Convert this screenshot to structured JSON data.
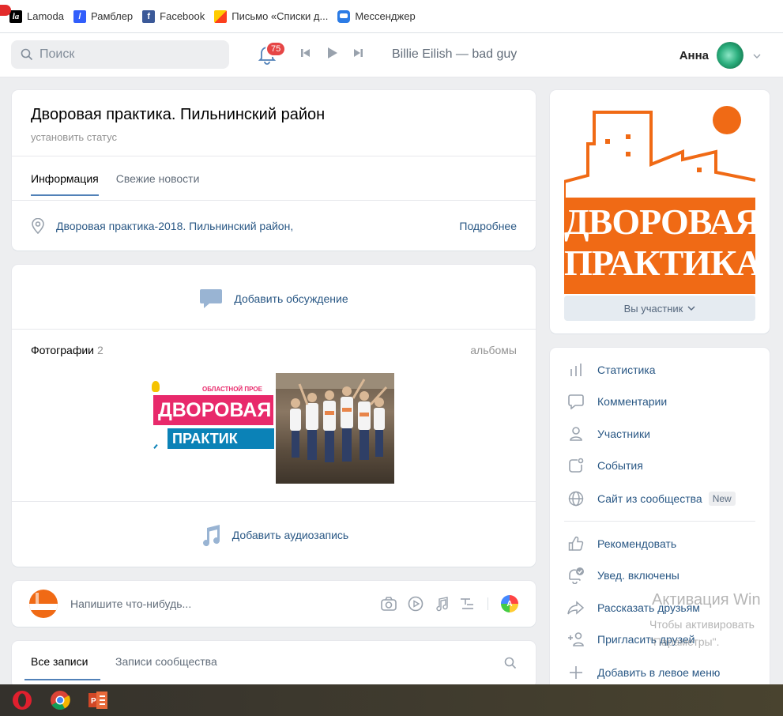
{
  "bookmarks": [
    {
      "label": "Lamoda",
      "icon": "lamoda-icon",
      "color": "#000000",
      "glyph": "la"
    },
    {
      "label": "Рамблер",
      "icon": "rambler-icon",
      "color": "#315efb",
      "glyph": "/"
    },
    {
      "label": "Facebook",
      "icon": "facebook-icon",
      "color": "#3b5998",
      "glyph": "f"
    },
    {
      "label": "Письмо «Списки д...",
      "icon": "mail-icon",
      "color": "#fc3f1d",
      "glyph": "✉"
    },
    {
      "label": "Мессенджер",
      "icon": "messenger-icon",
      "color": "#2b7be5",
      "glyph": "•"
    }
  ],
  "header": {
    "search_placeholder": "Поиск",
    "notifications_count": "75",
    "track": "Billie Eilish — bad guy",
    "user_name": "Анна"
  },
  "group": {
    "title": "Дворовая практика. Пильнинский район",
    "status": "установить статус",
    "tabs": [
      "Информация",
      "Свежие новости"
    ],
    "info_text": "Дворовая практика-2018. Пильнинский район,",
    "more_label": "Подробнее"
  },
  "content": {
    "add_discussion": "Добавить обсуждение",
    "photos_label": "Фотографии",
    "photos_count": "2",
    "albums_label": "альбомы",
    "photo1_line1": "ОБЛАСТНОЙ ПРОЕ",
    "photo1_line2": "ДВОРОВАЯ",
    "photo1_line3": "ПРАКТИК",
    "add_audio": "Добавить аудиозапись",
    "composer_placeholder": "Напишите что-нибудь...",
    "feed_tabs": [
      "Все записи",
      "Записи сообщества"
    ]
  },
  "sidebar": {
    "logo_line1": "ДВОРОВАЯ",
    "logo_line2": "ПРАКТИКА",
    "member_button": "Вы участник",
    "menu": [
      {
        "label": "Статистика",
        "icon": "stats-icon"
      },
      {
        "label": "Комментарии",
        "icon": "comment-icon"
      },
      {
        "label": "Участники",
        "icon": "user-icon"
      },
      {
        "label": "События",
        "icon": "events-icon"
      },
      {
        "label": "Сайт из сообщества",
        "icon": "globe-icon",
        "badge": "New"
      },
      {
        "label": "Рекомендовать",
        "icon": "thumbs-up-icon"
      },
      {
        "label": "Увед. включены",
        "icon": "bell-check-icon"
      },
      {
        "label": "Рассказать друзьям",
        "icon": "share-icon"
      },
      {
        "label": "Пригласить друзей",
        "icon": "add-user-icon"
      },
      {
        "label": "Добавить в левое меню",
        "icon": "plus-icon"
      }
    ]
  },
  "watermark": {
    "line1": "Активация Win",
    "line2": "Чтобы активировать",
    "line3": "\"Параметры\"."
  },
  "colors": {
    "accent": "#5181b8",
    "link": "#2a5885",
    "logo_orange": "#f06a15",
    "badge_red": "#e64646"
  }
}
